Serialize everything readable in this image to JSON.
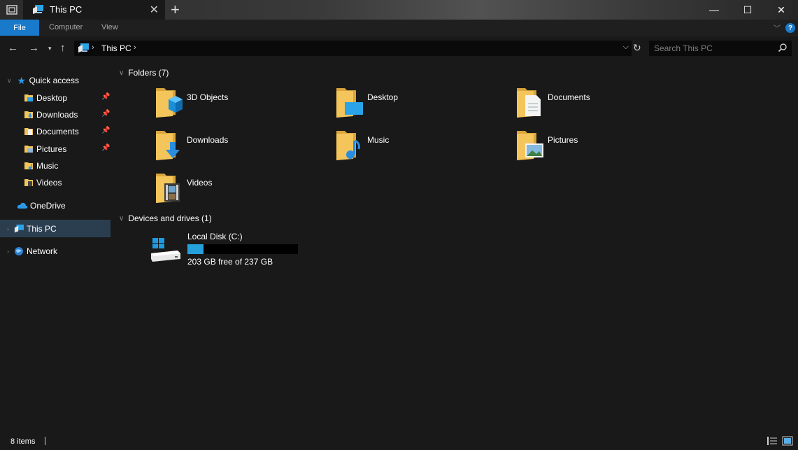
{
  "window": {
    "tab_title": "This PC",
    "controls": {
      "minimize": "—",
      "maximize": "☐",
      "close": "✕"
    }
  },
  "ribbon": {
    "tabs": [
      "File",
      "Computer",
      "View"
    ],
    "help": "?"
  },
  "address": {
    "path": "This PC",
    "search_placeholder": "Search This PC"
  },
  "sidebar": {
    "quick_access": "Quick access",
    "quick_items": [
      {
        "label": "Desktop",
        "pinned": true
      },
      {
        "label": "Downloads",
        "pinned": true
      },
      {
        "label": "Documents",
        "pinned": true
      },
      {
        "label": "Pictures",
        "pinned": true
      },
      {
        "label": "Music",
        "pinned": false
      },
      {
        "label": "Videos",
        "pinned": false
      }
    ],
    "onedrive": "OneDrive",
    "this_pc": "This PC",
    "network": "Network"
  },
  "main": {
    "folders_header": "Folders (7)",
    "folders": [
      {
        "label": "3D Objects",
        "icon": "3d-objects-folder-icon"
      },
      {
        "label": "Desktop",
        "icon": "desktop-folder-icon"
      },
      {
        "label": "Documents",
        "icon": "documents-folder-icon"
      },
      {
        "label": "Downloads",
        "icon": "downloads-folder-icon"
      },
      {
        "label": "Music",
        "icon": "music-folder-icon"
      },
      {
        "label": "Pictures",
        "icon": "pictures-folder-icon"
      },
      {
        "label": "Videos",
        "icon": "videos-folder-icon"
      }
    ],
    "devices_header": "Devices and drives (1)",
    "drive": {
      "name": "Local Disk (C:)",
      "free_text": "203 GB free of 237 GB",
      "used_fraction": 0.143
    }
  },
  "status": {
    "items": "8 items"
  },
  "colors": {
    "accent": "#1979ca",
    "background": "#191919",
    "selection": "#2b3e50",
    "drive_bar": "#26a0da",
    "folder_yellow": "#f3c55b"
  }
}
